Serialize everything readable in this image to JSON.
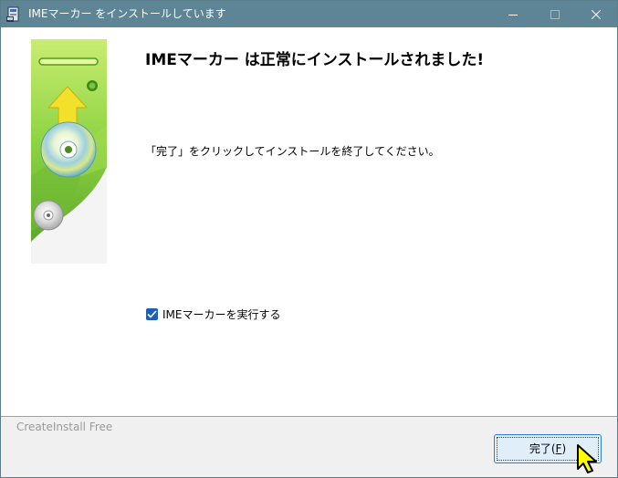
{
  "window": {
    "title": "IMEマーカー をインストールしています",
    "app_icon": "installer-app-icon",
    "controls": {
      "minimize_icon": "minimize-icon",
      "maximize_icon": "maximize-icon",
      "close_icon": "close-icon"
    }
  },
  "main": {
    "heading_bold": "IME",
    "heading_rest": "マーカー は正常にインストールされました!",
    "instruction": "「完了」をクリックしてインストールを終了してください。",
    "run_checkbox": {
      "label": "IMEマーカーを実行する",
      "checked": true
    },
    "side_graphic": "install-cd-graphic"
  },
  "footer": {
    "brand": "CreateInstall Free",
    "finish_button": {
      "label": "完了(",
      "mnemonic": "F",
      "label_end": ")"
    }
  },
  "colors": {
    "titlebar": "#5d8596",
    "checkbox": "#1b5fb8",
    "button_border": "#2a7fd6",
    "button_fill": "#e0eef9",
    "graphic_green": "#7cc23a"
  }
}
